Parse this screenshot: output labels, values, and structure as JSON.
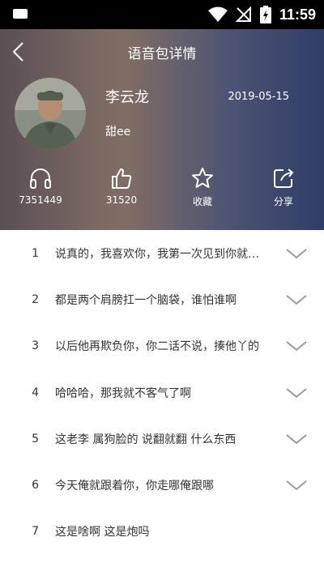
{
  "status_bar": {
    "time": "11:59",
    "app_icon_text": "IMAGE"
  },
  "header": {
    "title": "语音包详情",
    "name": "李云龙",
    "date": "2019-05-15",
    "description": "甜ee"
  },
  "stats": [
    {
      "icon": "headphones-icon",
      "label": "7351449"
    },
    {
      "icon": "thumbs-up-icon",
      "label": "31520"
    },
    {
      "icon": "star-icon",
      "label": "收藏"
    },
    {
      "icon": "share-icon",
      "label": "分享"
    }
  ],
  "tracks": [
    {
      "num": "1",
      "text": "说真的，我喜欢你，我第一次见到你就喜欢你"
    },
    {
      "num": "2",
      "text": "都是两个肩膀扛一个脑袋，谁怕谁啊"
    },
    {
      "num": "3",
      "text": "以后他再欺负你，你二话不说，揍他丫的"
    },
    {
      "num": "4",
      "text": "哈哈哈，那我就不客气了啊"
    },
    {
      "num": "5",
      "text": "这老李 属狗脸的 说翻就翻 什么东西"
    },
    {
      "num": "6",
      "text": "今天俺就跟着你，你走哪俺跟哪"
    },
    {
      "num": "7",
      "text": "这是啥啊 这是炮吗"
    }
  ],
  "colors": {
    "header_start": "#5a4f55",
    "header_end": "#2f3d67",
    "chevron": "#9a9a9a"
  }
}
